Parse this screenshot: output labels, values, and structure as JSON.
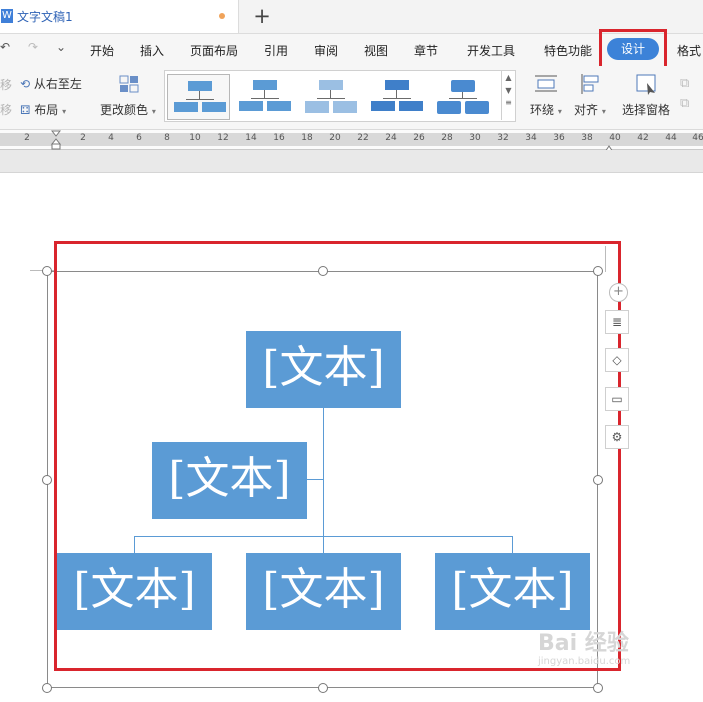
{
  "tab": {
    "doc_icon": "W",
    "title": "文字文稿1",
    "new_tab": "+"
  },
  "menu": {
    "undo": "↶",
    "redo": "↷",
    "quick_access": "⌄",
    "items": [
      "开始",
      "插入",
      "页面布局",
      "引用",
      "审阅",
      "视图",
      "章节",
      "开发工具",
      "特色功能",
      "设计",
      "格式"
    ],
    "active": "设计"
  },
  "ribbon": {
    "demote_label": "移",
    "right_to_left": "从右至左",
    "promote_label": "移",
    "layout": "布局",
    "change_color": "更改颜色",
    "wrap": "环绕",
    "align": "对齐",
    "selection_pane": "选择窗格"
  },
  "ruler": {
    "ticks": [
      "2",
      "2",
      "4",
      "6",
      "8",
      "10",
      "12",
      "14",
      "16",
      "18",
      "20",
      "22",
      "24",
      "26",
      "28",
      "30",
      "32",
      "34",
      "36",
      "38",
      "40",
      "42",
      "44",
      "46"
    ]
  },
  "smartart": {
    "nodes": [
      "[文本]",
      "[文本]",
      "[文本]",
      "[文本]",
      "[文本]"
    ],
    "fill_color": "#5b9bd5"
  },
  "side_toolbar": {
    "zoom": "+",
    "buttons": [
      "layout-options-icon",
      "shape-icon",
      "frame-icon",
      "format-icon"
    ]
  },
  "watermark": {
    "main": "Bai 经验",
    "sub": "jingyan.baidu.com"
  },
  "colors": {
    "accent": "#3c82d8",
    "highlight": "#d9252d"
  }
}
